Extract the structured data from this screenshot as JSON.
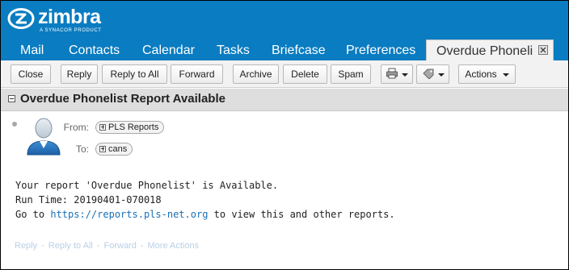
{
  "app": {
    "logo_text": "zimbra",
    "logo_subtext": "A SYNACOR PRODUCT"
  },
  "tabs": [
    {
      "label": "Mail"
    },
    {
      "label": "Contacts"
    },
    {
      "label": "Calendar"
    },
    {
      "label": "Tasks"
    },
    {
      "label": "Briefcase"
    },
    {
      "label": "Preferences"
    },
    {
      "label": "Overdue Phoneli",
      "active": true
    }
  ],
  "toolbar": {
    "close": "Close",
    "reply": "Reply",
    "reply_all": "Reply to All",
    "forward": "Forward",
    "archive": "Archive",
    "delete": "Delete",
    "spam": "Spam",
    "print_icon": "print-icon",
    "tag_icon": "tag-icon",
    "actions": "Actions"
  },
  "message": {
    "subject": "Overdue Phonelist Report Available",
    "from_label": "From:",
    "from": "PLS Reports",
    "to_label": "To:",
    "to": "cans",
    "body_line1": "Your report 'Overdue Phonelist' is Available.",
    "body_line2": "Run Time: 20190401-070018",
    "body_line3_prefix": "Go to ",
    "body_link": "https://reports.pls-net.org",
    "body_line3_suffix": " to view this and other reports."
  },
  "footer": {
    "reply": "Reply",
    "reply_all": "Reply to All",
    "forward": "Forward",
    "more": "More Actions",
    "separator": "-"
  },
  "colors": {
    "header_blue": "#0a7cc1",
    "link_blue": "#1a6fb5"
  }
}
